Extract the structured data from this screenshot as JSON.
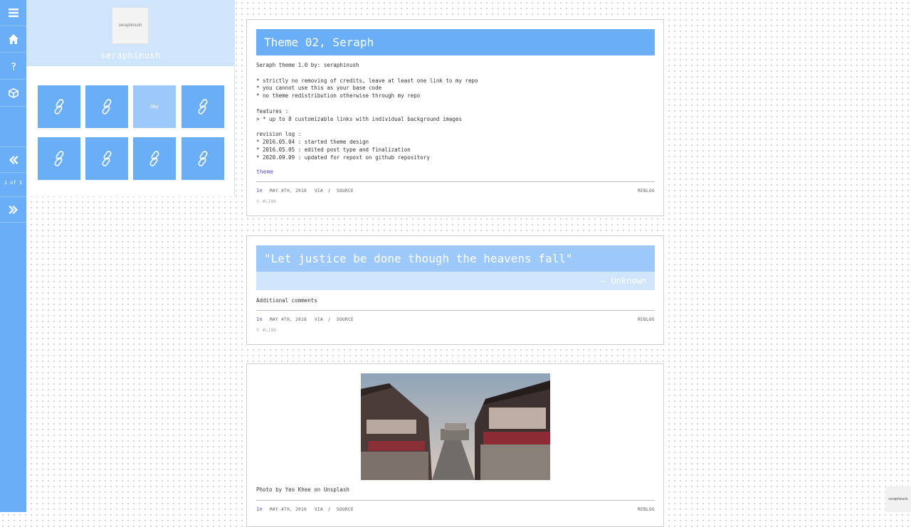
{
  "blog": {
    "avatar_text": "seraphinush",
    "title": "seraphinush"
  },
  "rail": {
    "menu_icon": "hamburger-icon",
    "home_icon": "home-icon",
    "help_icon": "question-icon",
    "box_icon": "cube-icon",
    "prev_icon": "double-chevron-left-icon",
    "next_icon": "double-chevron-right-icon",
    "pager": "1 of 1"
  },
  "links": {
    "icon": "link-icon",
    "hover_label": "Sky"
  },
  "posts": [
    {
      "title": "Theme 02, Seraph",
      "body": "Seraph theme 1.0 by: seraphinush\n\n* strictly no removing of credits, leave at least one link to my repo\n* you cannot use this as your base code\n* no theme redistribution otherwise through my repo\n\nfeatures :\n> * up to 8 customizable links with individual background images\n\nrevision log :\n* 2016.05.04 : started theme design\n* 2016.05.05 : edited post type and finalization\n* 2020.09.09 : updated for repost on github repository",
      "tag": "theme",
      "notes": "1e",
      "date": "MAY 4TH, 2016",
      "via": "VIA",
      "sep": "/",
      "source": "SOURCE",
      "reblog": "REBLOG",
      "permalink": "#LINK"
    },
    {
      "quote": "\"Let justice be done though the heavens fall\"",
      "quote_source": "— Unknown",
      "body": "Additional comments",
      "notes": "1e",
      "date": "MAY 4TH, 2016",
      "via": "VIA",
      "sep": "/",
      "source": "SOURCE",
      "reblog": "REBLOG",
      "permalink": "#LINK"
    },
    {
      "caption": "Photo by Yeo Khee on Unsplash",
      "notes": "1e",
      "date": "MAY 4TH, 2016",
      "via": "VIA",
      "sep": "/",
      "source": "SOURCE",
      "reblog": "REBLOG"
    }
  ],
  "corner_badge": "seraphinush",
  "colors": {
    "accent": "#6aaef7",
    "accent_light": "#9cc9fa",
    "accent_pale": "#cfe5fc",
    "tag": "#5a5ab8"
  }
}
